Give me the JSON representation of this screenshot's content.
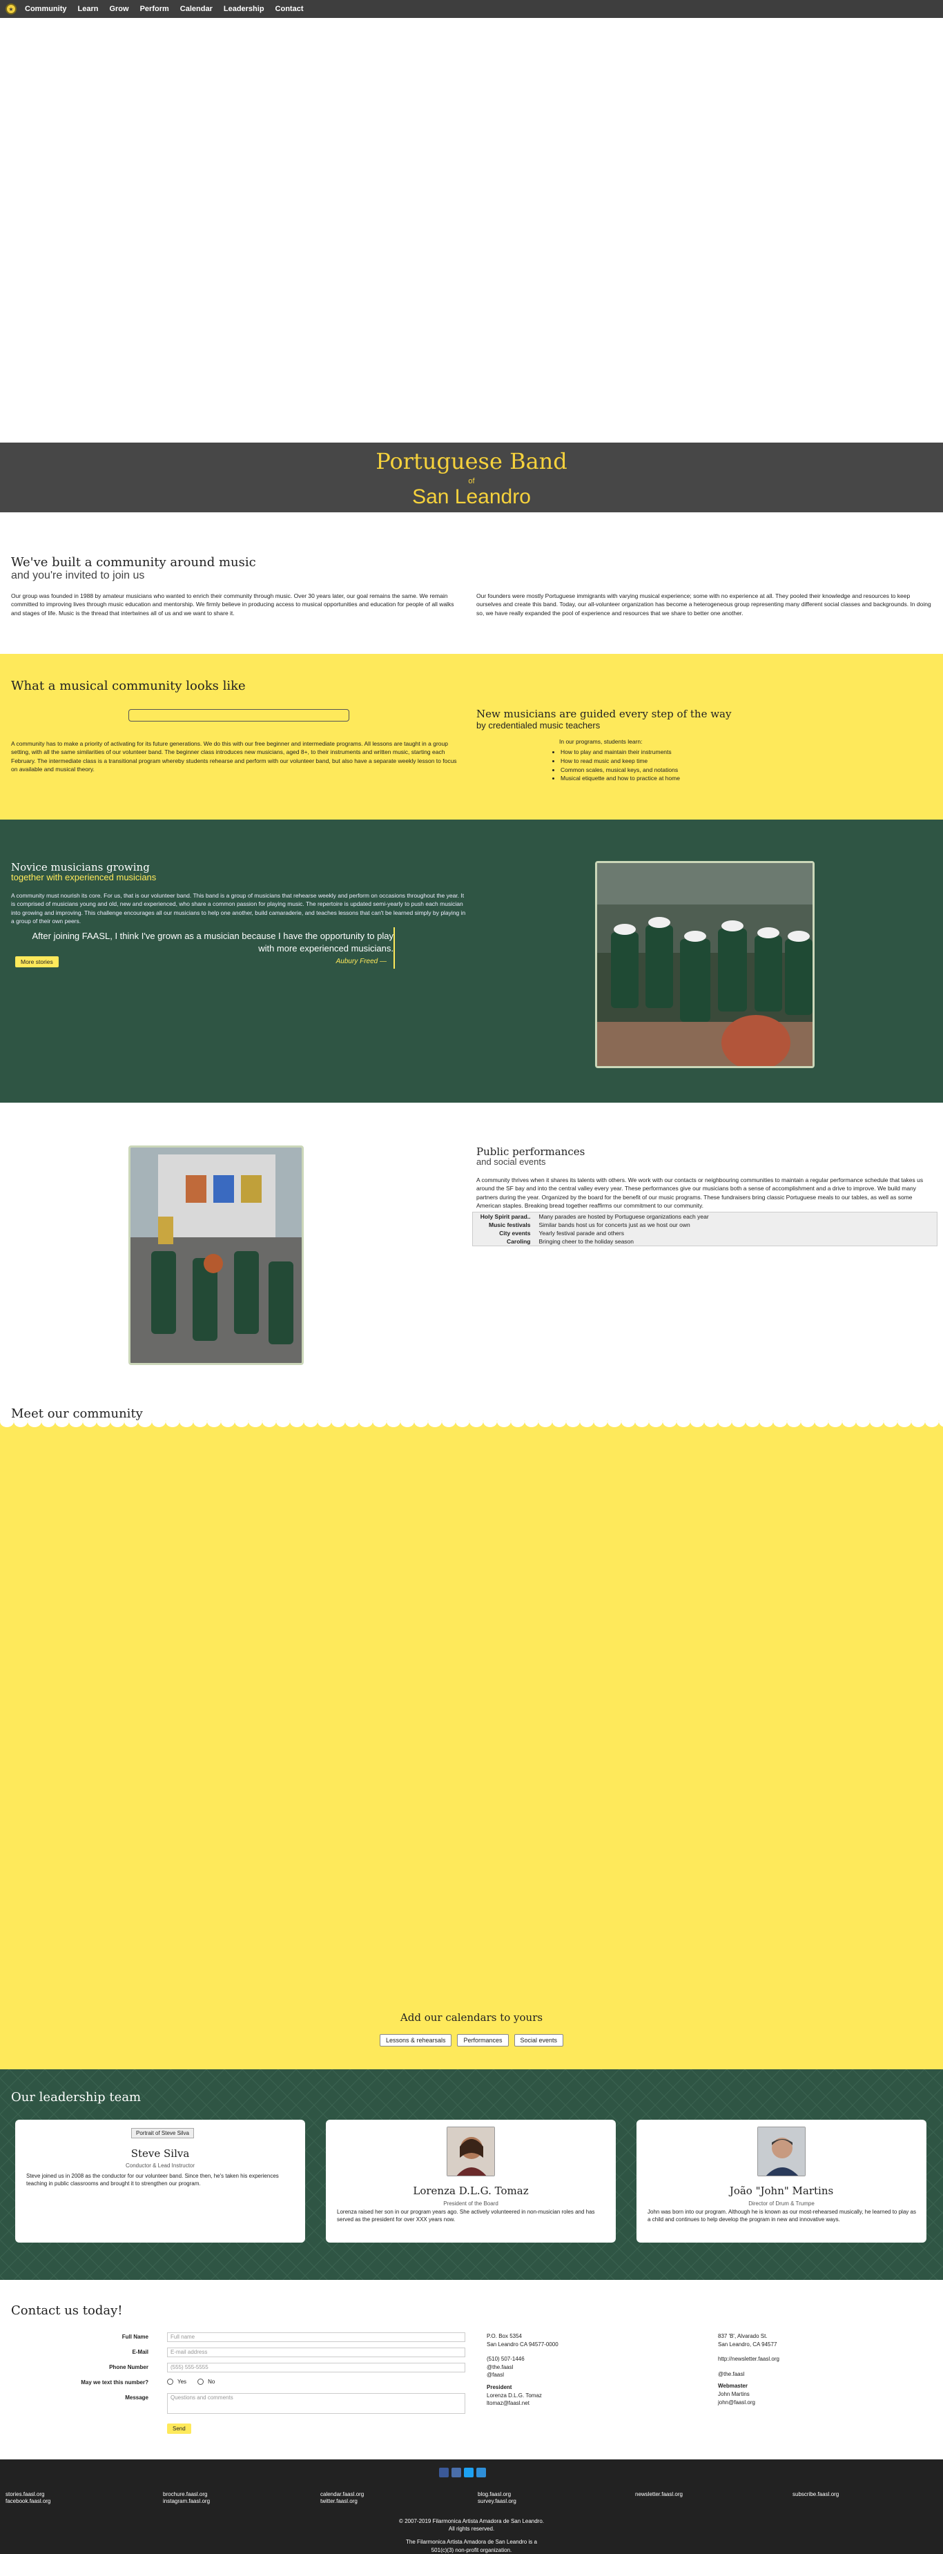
{
  "nav": {
    "items": [
      "Community",
      "Learn",
      "Grow",
      "Perform",
      "Calendar",
      "Leadership",
      "Contact"
    ]
  },
  "banner": {
    "line1": "Portuguese Band",
    "line2": "of",
    "line3": "San Leandro"
  },
  "intro": {
    "heading": "We've built a community around music",
    "subheading": "and you're invited to join us",
    "col1": "Our group was founded in 1988 by amateur musicians who wanted to enrich their community through music. Over 30 years later, our goal remains the same. We remain committed to improving lives through music education and mentorship. We firmly believe in producing access to musical opportunities and education for people of all walks and stages of life. Music is the thread that intertwines all of us and we want to share it.",
    "col2": "Our founders were mostly Portuguese immigrants with varying musical experience; some with no experience at all. They pooled their knowledge and resources to keep ourselves and create this band. Today, our all-volunteer organization has become a heterogeneous group representing many different social classes and backgrounds. In doing so, we have really expanded the pool of experience and resources that we share to better one another."
  },
  "musical": {
    "heading": "What a musical community looks like",
    "paragraph": "A community has to make a priority of activating for its future generations. We do this with our free beginner and intermediate programs. All lessons are taught in a group setting, with all the same similarities of our volunteer band. The beginner class introduces new musicians, aged 8+, to their instruments and written music, starting each February. The intermediate class is a transitional program whereby students rehearse and perform with our volunteer band, but also have a separate weekly lesson to focus on available and musical theory.",
    "right_heading": "New musicians are guided every step of the way",
    "right_sub": "by credentialed music teachers",
    "lead": "In our programs, students learn:",
    "list": [
      "How to play and maintain their instruments",
      "How to read music and keep time",
      "Common scales, musical keys, and notations",
      "Musical etiquette and how to practice at home"
    ]
  },
  "novice": {
    "heading": "Novice musicians growing",
    "subheading": "together with experienced musicians",
    "paragraph": "A community must nourish its core. For us, that is our volunteer band. This band is a group of musicians that rehearse weekly and perform on occasions throughout the year. It is comprised of musicians young and old, new and experienced, who share a common passion for playing music. The repertoire is updated semi-yearly to push each musician into growing and improving. This challenge encourages all our musicians to help one another, build camaraderie, and teaches lessons that can't be learned simply by playing in a group of their own peers.",
    "quote": "After joining FAASL, I think I've grown as a musician because I have the opportunity to play with more experienced musicians.",
    "cite": "Aubury Freed —",
    "button": "More stories"
  },
  "perf": {
    "heading": "Public performances",
    "subheading": "and social events",
    "paragraph": "A community thrives when it shares its talents with others. We work with our contacts or neighbouring communities to maintain a regular performance schedule that takes us around the SF bay and into the central valley every year. These performances give our musicians both a sense of accomplishment and a drive to improve. We build many partners during the year. Organized by the board for the benefit of our music programs. These fundraisers bring classic Portuguese meals to our tables, as well as some American staples. Breaking bread together reaffirms our commitment to our community.",
    "rows": [
      {
        "k": "Holy Spirit parad..",
        "v": "Many parades are hosted by Portuguese organizations each year"
      },
      {
        "k": "Music festivals",
        "v": "Similar bands host us for concerts just as we host our own"
      },
      {
        "k": "City events",
        "v": "Yearly festival parade and others"
      },
      {
        "k": "Caroling",
        "v": "Bringing cheer to the holiday season"
      }
    ]
  },
  "meet": {
    "heading": "Meet our community",
    "calendar_heading": "Add our calendars to yours",
    "calendars": [
      "Lessons & rehearsals",
      "Performances",
      "Social events"
    ]
  },
  "leadership": {
    "heading": "Our leadership team",
    "people": [
      {
        "name": "Steve Silva",
        "role": "Conductor & Lead Instructor",
        "photo_label": "Portrait of Steve Silva",
        "bio": "Steve joined us in 2008 as the conductor for our volunteer band. Since then, he's taken his experiences teaching in public classrooms and brought it to strengthen our program."
      },
      {
        "name": "Lorenza D.L.G. Tomaz",
        "role": "President of the Board",
        "bio": "Lorenza raised her son in our program years ago. She actively volunteered in non-musician roles and has served as the president for over XXX years now."
      },
      {
        "name": "João \"John\" Martins",
        "role": "Director of Drum & Trumpe",
        "bio": "John was born into our program. Although he is known as our most-rehearsed musically, he learned to play as a child and continues to help develop the program in new and innovative ways."
      }
    ]
  },
  "contact": {
    "heading": "Contact us today!",
    "fields": [
      {
        "label": "Full Name",
        "placeholder": "Full name"
      },
      {
        "label": "E-Mail",
        "placeholder": "E-mail address"
      },
      {
        "label": "Phone Number",
        "placeholder": "(555) 555-5555"
      }
    ],
    "text_label": "May we text this number?",
    "yes": "Yes",
    "no": "No",
    "message_label": "Message",
    "message_placeholder": "Questions and comments",
    "send": "Send",
    "mid_col": [
      "P.O. Box 5354",
      "San Leandro CA 94577-0000",
      "",
      "(510) 507-1446",
      "@the.faasl",
      "@faasl"
    ],
    "mid_president": "President",
    "mid_pres_lines": [
      "Lorenza D.L.G. Tomaz",
      "ltomaz@faasl.net"
    ],
    "right_col": [
      "837 'B', Alvarado St.",
      "San Leandro, CA 94577",
      "",
      "http://newsletter.faasl.org",
      "",
      "@the.faasl"
    ],
    "right_webmaster": "Webmaster",
    "right_web_lines": [
      "John Martins",
      "john@faasl.org"
    ]
  },
  "footer": {
    "links": [
      [
        "stories.faasl.org",
        "facebook.faasl.org"
      ],
      [
        "brochure.faasl.org",
        "instagram.faasl.org"
      ],
      [
        "calendar.faasl.org",
        "twitter.faasl.org"
      ],
      [
        "blog.faasl.org",
        "survey.faasl.org"
      ],
      [
        "newsletter.faasl.org"
      ],
      [
        "subscribe.faasl.org"
      ]
    ],
    "copy1": "© 2007-2019 Filarmonica Artista Amadora de San Leandro.",
    "copy2": "All rights reserved.",
    "copy3": "The Filarmonica Artista Amadora de San Leandro is a",
    "copy4": "501(c)(3) non-profit organization.",
    "social_colors": [
      "#3b5998",
      "#4a6ea9",
      "#1da1f2",
      "#2f8fd8"
    ]
  }
}
